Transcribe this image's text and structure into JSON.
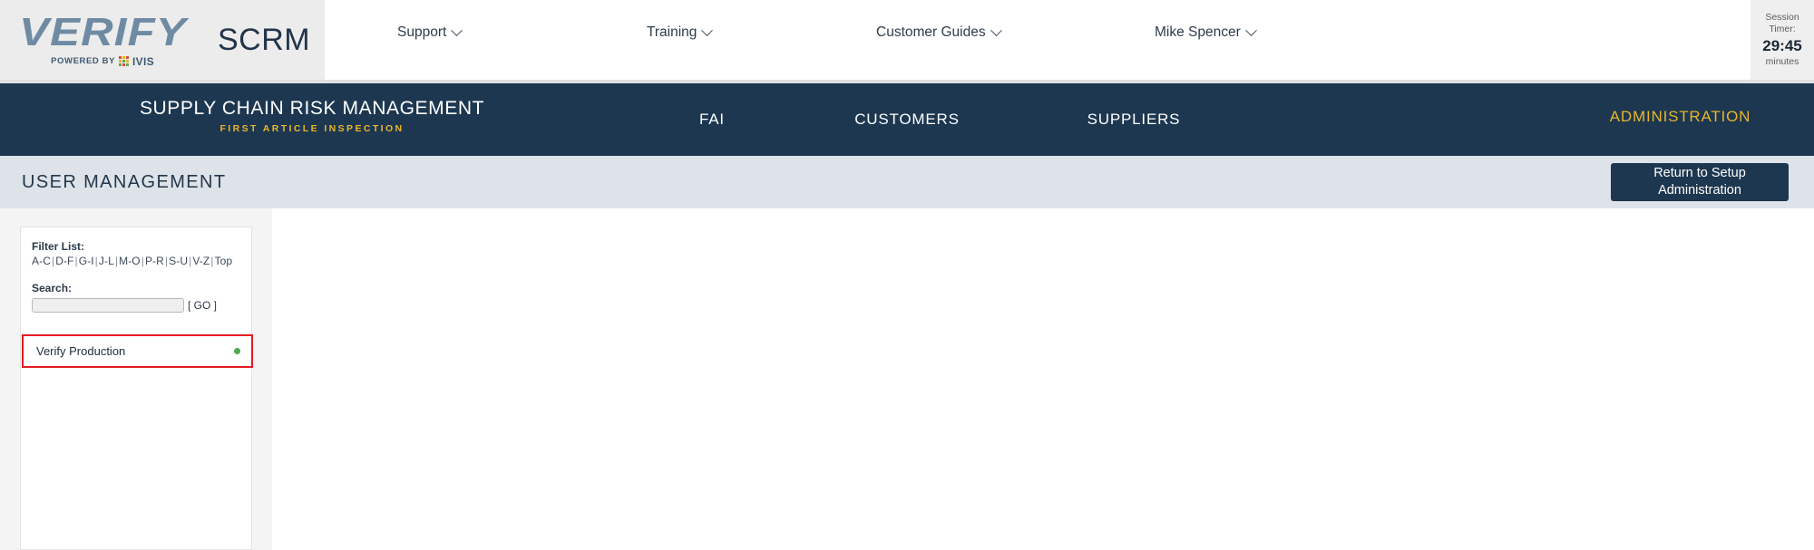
{
  "brand": {
    "logo_wordmark": "VERIFY",
    "logo_powered_by": "POWERED BY",
    "logo_ivis": "IVIS",
    "product_label": "SCRM",
    "ivis_icon": "ivis-squares-icon",
    "accent_navy": "#1d3750",
    "accent_gold": "#e8b62c",
    "accent_red": "#e51b24",
    "status_green": "#4caa50"
  },
  "topnav": {
    "items": [
      {
        "label": "Support",
        "icon": "chevron-down-icon"
      },
      {
        "label": "Training",
        "icon": "chevron-down-icon"
      },
      {
        "label": "Customer Guides",
        "icon": "chevron-down-icon"
      },
      {
        "label": "Mike Spencer",
        "icon": "chevron-down-icon"
      }
    ]
  },
  "session": {
    "label_line1": "Session",
    "label_line2": "Timer:",
    "value": "29:45",
    "unit": "minutes"
  },
  "navband": {
    "title": "SUPPLY CHAIN RISK MANAGEMENT",
    "subtitle": "FIRST ARTICLE INSPECTION",
    "tabs": [
      {
        "label": "FAI",
        "active": false
      },
      {
        "label": "CUSTOMERS",
        "active": false
      },
      {
        "label": "SUPPLIERS",
        "active": false
      },
      {
        "label": "ADMINISTRATION",
        "active": true
      }
    ]
  },
  "titlebar": {
    "page_title": "USER MANAGEMENT",
    "return_button": "Return to Setup Administration"
  },
  "sidebar": {
    "filter_label": "Filter List:",
    "filter_links": [
      "A-C",
      "D-F",
      "G-I",
      "J-L",
      "M-O",
      "P-R",
      "S-U",
      "V-Z",
      "Top"
    ],
    "search_label": "Search:",
    "search_value": "",
    "search_placeholder": "",
    "go_label": "[ GO ]",
    "results": [
      {
        "name": "Verify Production",
        "status": "active",
        "status_icon": "green-dot-icon"
      }
    ]
  }
}
